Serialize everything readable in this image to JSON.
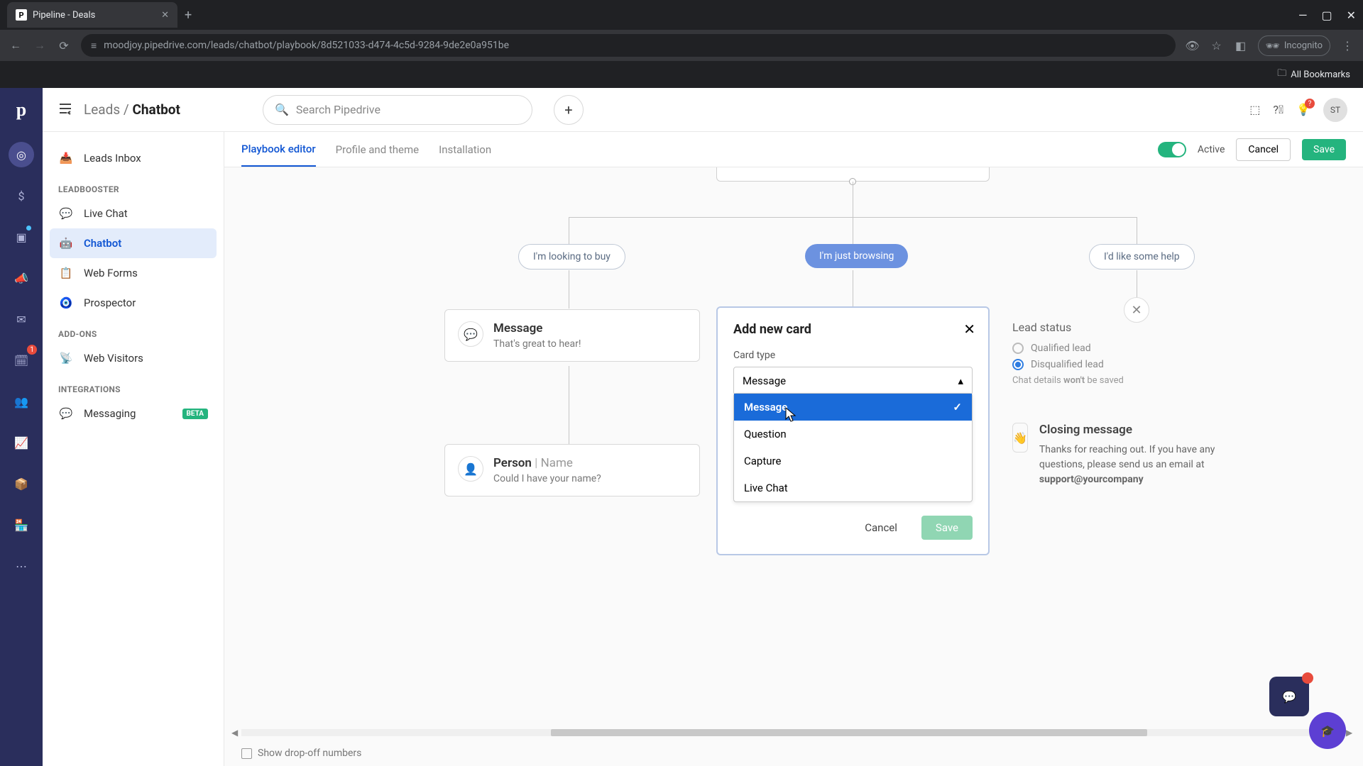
{
  "browser": {
    "tab_title": "Pipeline - Deals",
    "url": "moodjoy.pipedrive.com/leads/chatbot/playbook/8d521033-d474-4c5d-9284-9de2e0a951be",
    "incognito_label": "Incognito",
    "bookmarks_label": "All Bookmarks"
  },
  "header": {
    "breadcrumb_root": "Leads",
    "breadcrumb_current": "Chatbot",
    "search_placeholder": "Search Pipedrive",
    "avatar_initials": "ST"
  },
  "sidebar": {
    "top_item": "Leads Inbox",
    "section1": "LEADBOOSTER",
    "items1": [
      "Live Chat",
      "Chatbot",
      "Web Forms",
      "Prospector"
    ],
    "section2": "ADD-ONS",
    "items2": [
      "Web Visitors"
    ],
    "section3": "INTEGRATIONS",
    "items3": [
      "Messaging"
    ],
    "beta_label": "BETA"
  },
  "tabs": {
    "items": [
      "Playbook editor",
      "Profile and theme",
      "Installation"
    ],
    "active_label": "Active",
    "cancel": "Cancel",
    "save": "Save"
  },
  "flow": {
    "choice1": "I'm looking to buy",
    "choice2": "I'm just browsing",
    "choice3": "I'd like some help",
    "message_card": {
      "title": "Message",
      "body": "That's great to hear!"
    },
    "person_card": {
      "title_left": "Person",
      "title_right": "Name",
      "body": "Could I have your name?"
    },
    "status": {
      "title": "Lead status",
      "opt1": "Qualified lead",
      "opt2": "Disqualified lead",
      "note_pre": "Chat details ",
      "note_strong": "won't",
      "note_post": " be saved"
    },
    "closing": {
      "title": "Closing message",
      "body": "Thanks for reaching out. If you have any questions, please send us an email at ",
      "email": "support@yourcompany"
    },
    "dropoff_label": "Show drop-off numbers"
  },
  "modal": {
    "title": "Add new card",
    "label": "Card type",
    "selected": "Message",
    "options": [
      "Message",
      "Question",
      "Capture",
      "Live Chat"
    ],
    "cancel": "Cancel",
    "save": "Save"
  },
  "rail": {
    "badge_count": "1"
  }
}
